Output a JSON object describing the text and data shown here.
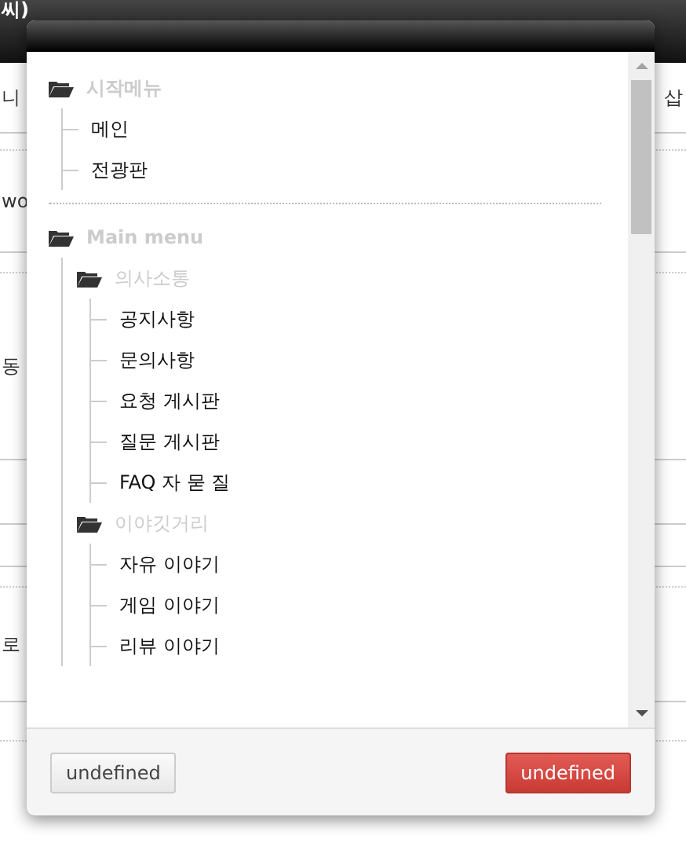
{
  "background": {
    "title": "씨)",
    "left_texts": [
      "니",
      "wo",
      "동",
      "로"
    ],
    "right_texts": [
      "삽"
    ]
  },
  "dialog": {
    "tree": [
      {
        "label": "시작메뉴",
        "kind": "folder",
        "children": [
          {
            "label": "메인",
            "kind": "leaf"
          },
          {
            "label": "전광판",
            "kind": "leaf"
          }
        ]
      },
      {
        "label": "Main menu",
        "kind": "folder",
        "children": [
          {
            "label": "의사소통",
            "kind": "folder",
            "children": [
              {
                "label": "공지사항",
                "kind": "leaf"
              },
              {
                "label": "문의사항",
                "kind": "leaf"
              },
              {
                "label": "요청 게시판",
                "kind": "leaf"
              },
              {
                "label": "질문 게시판",
                "kind": "leaf"
              },
              {
                "label": "FAQ 자 묻 질",
                "kind": "leaf"
              }
            ]
          },
          {
            "label": "이야깃거리",
            "kind": "folder",
            "children": [
              {
                "label": "자유 이야기",
                "kind": "leaf"
              },
              {
                "label": "게임 이야기",
                "kind": "leaf"
              },
              {
                "label": "리뷰 이야기",
                "kind": "leaf"
              }
            ]
          }
        ]
      }
    ],
    "buttons": [
      {
        "label": "undefined",
        "kind": "default"
      },
      {
        "label": "undefined",
        "kind": "danger"
      }
    ]
  }
}
